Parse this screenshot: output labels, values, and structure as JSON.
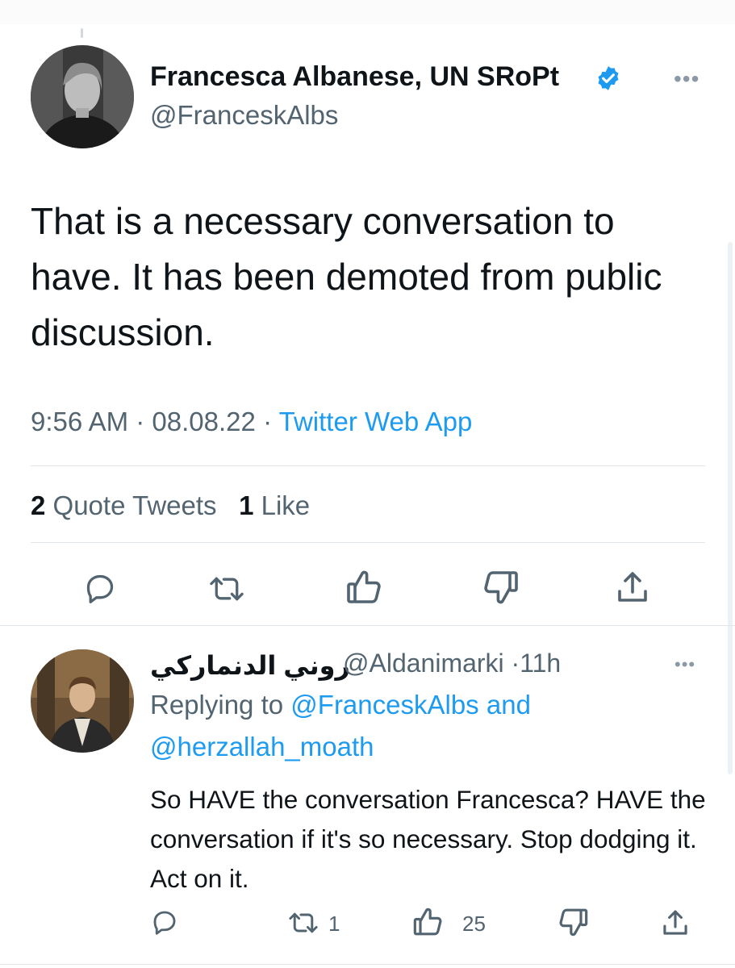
{
  "tweet": {
    "author_name": "Francesca Albanese, UN SRoPt",
    "author_handle": "@FranceskAlbs",
    "more_icon": "•••",
    "text": "That is a necessary conversation to have. It has been demoted from public discussion.",
    "time": "9:56 AM",
    "date": "08.08.22",
    "separator": "·",
    "source": "Twitter Web App",
    "quote_count": "2",
    "quote_label": "Quote Tweets",
    "like_count": "1",
    "like_label": "Like",
    "actions": [
      "reply-icon",
      "retweet-icon",
      "like-icon",
      "dislike-icon",
      "share-icon"
    ]
  },
  "reply": {
    "author_name": "روني الدنماركي",
    "author_handle": "@Aldanimarki",
    "separator": "·",
    "time_ago": "11h",
    "more_icon": "•••",
    "replying_prefix": "Replying to",
    "replying_user1": "@FranceskAlbs",
    "replying_and": "and",
    "replying_user2": "@herzallah_moath",
    "text": "So HAVE the conversation Francesca? HAVE the conversation if it's so necessary. Stop dodging it. Act on it.",
    "retweet_count": "1",
    "like_count": "25"
  },
  "colors": {
    "link": "#1d9bf0",
    "secondary_text": "#536471",
    "primary_text": "#0f1419",
    "divider": "#dfe5e8"
  }
}
